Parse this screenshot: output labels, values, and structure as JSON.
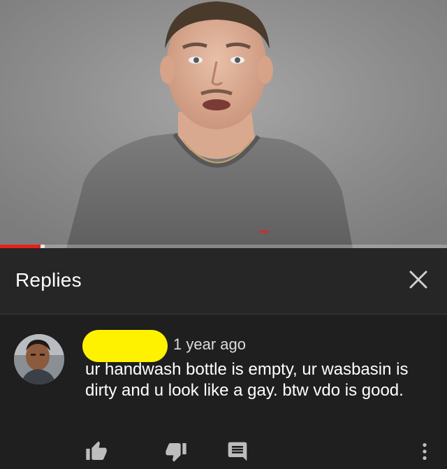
{
  "video": {
    "progress_fraction": 0.09,
    "buffer_fraction": 0.01,
    "progress_color": "#e62117"
  },
  "replies_panel": {
    "title": "Replies",
    "close_icon": "close-icon"
  },
  "comment": {
    "author_redaction_color": "#fff200",
    "timestamp": "1 year ago",
    "text": "ur handwash bottle is empty, ur wasbasin is dirty and u look like a gay. btw vdo is good.",
    "actions": {
      "like_icon": "thumbs-up-icon",
      "dislike_icon": "thumbs-down-icon",
      "reply_icon": "reply-icon",
      "more_icon": "more-vertical-icon"
    }
  }
}
